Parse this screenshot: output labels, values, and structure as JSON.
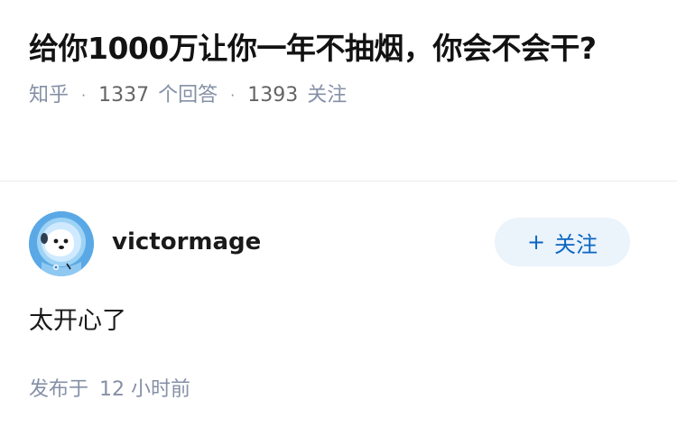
{
  "question": {
    "title": "给你1000万让你一年不抽烟，你会不会干?",
    "source": "知乎",
    "answer_count": "1337",
    "answer_label": "个回答",
    "follow_count": "1393",
    "follow_label": "关注",
    "separator": "·"
  },
  "answer": {
    "author": {
      "name": "victormage",
      "avatar_icon": "astronaut-dog-avatar"
    },
    "follow_button": {
      "icon": "plus-icon",
      "plus": "+",
      "label": "关注"
    },
    "content": "太开心了",
    "publish": {
      "prefix": "发布于",
      "time": "12 小时前"
    }
  },
  "colors": {
    "title": "#121212",
    "meta": "#8590a6",
    "accent": "#0a66c2",
    "follow_bg": "#ebf3fb",
    "avatar_bg": "#5aa9e6"
  }
}
